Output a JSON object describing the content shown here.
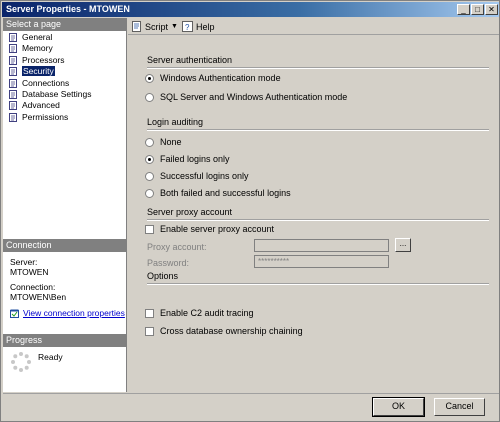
{
  "window": {
    "title": "Server Properties - MTOWEN",
    "controls": {
      "minimize": "_",
      "maximize": "□",
      "close": "✕"
    }
  },
  "left": {
    "select_header": "Select a page",
    "pages": [
      {
        "label": "General",
        "icon": "page-icon"
      },
      {
        "label": "Memory",
        "icon": "page-icon"
      },
      {
        "label": "Processors",
        "icon": "page-icon"
      },
      {
        "label": "Security",
        "icon": "page-icon",
        "selected": true
      },
      {
        "label": "Connections",
        "icon": "page-icon"
      },
      {
        "label": "Database Settings",
        "icon": "page-icon"
      },
      {
        "label": "Advanced",
        "icon": "page-icon"
      },
      {
        "label": "Permissions",
        "icon": "page-icon"
      }
    ],
    "connection_header": "Connection",
    "server_label": "Server:",
    "server_value": "MTOWEN",
    "connection_label": "Connection:",
    "connection_value": "MTOWEN\\Ben",
    "view_props_link": "View connection properties",
    "progress_header": "Progress",
    "progress_status": "Ready"
  },
  "toolbar": {
    "script_label": "Script",
    "help_label": "Help"
  },
  "security": {
    "server_auth_title": "Server authentication",
    "auth_options": [
      {
        "label": "Windows Authentication mode",
        "checked": true
      },
      {
        "label": "SQL Server and Windows Authentication mode",
        "checked": false
      }
    ],
    "login_audit_title": "Login auditing",
    "audit_options": [
      {
        "label": "None",
        "checked": false
      },
      {
        "label": "Failed logins only",
        "checked": true
      },
      {
        "label": "Successful logins only",
        "checked": false
      },
      {
        "label": "Both failed and successful logins",
        "checked": false
      }
    ],
    "proxy_title": "Server proxy account",
    "enable_proxy_label": "Enable server proxy account",
    "proxy_account_label": "Proxy account:",
    "proxy_account_value": "",
    "password_label": "Password:",
    "password_value": "**********",
    "browse_label": "...",
    "options_title": "Options",
    "c2_audit_label": "Enable C2 audit tracing",
    "cross_db_label": "Cross database ownership chaining"
  },
  "buttons": {
    "ok": "OK",
    "cancel": "Cancel"
  }
}
